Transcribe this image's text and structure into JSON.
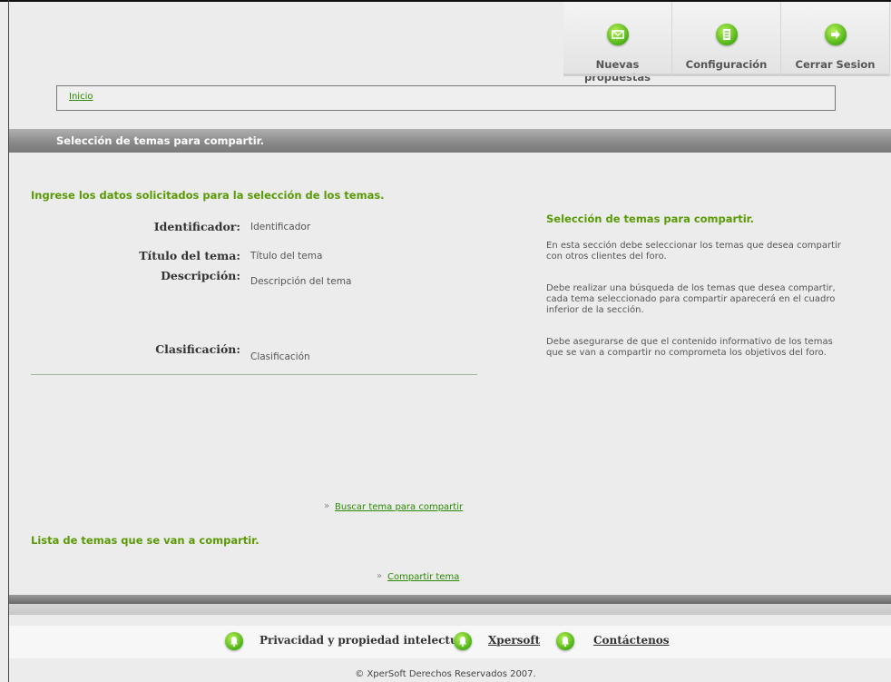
{
  "topnav": {
    "items": [
      {
        "label": "Nuevas propuestas",
        "icon": "envelope-icon"
      },
      {
        "label": "Configuración",
        "icon": "document-icon"
      },
      {
        "label": "Cerrar Sesion",
        "icon": "arrow-right-icon"
      }
    ]
  },
  "breadcrumb": {
    "home": "Inicio"
  },
  "section": {
    "title": "Selección de temas para compartir."
  },
  "form": {
    "instruction": "Ingrese los datos solicitados para la selección de los temas.",
    "fields": [
      {
        "label": "Identificador:",
        "value": "Identificador"
      },
      {
        "label": "Título del tema:",
        "value": "Título del tema"
      },
      {
        "label": "Descripción:",
        "value": "Descripción del tema"
      },
      {
        "label": "Clasificación:",
        "value": "Clasificación"
      }
    ],
    "search_link": "Buscar tema para compartir"
  },
  "help": {
    "title": "Selección de temas para compartir.",
    "paragraphs": [
      "En esta sección debe seleccionar los temas que desea compartir con otros clientes del foro.",
      "Debe realizar una búsqueda de los temas que desea compartir, cada tema seleccionado para compartir aparecerá en el cuadro inferior de la sección.",
      "Debe asegurarse de que el contenido informativo de los temas que se van a compartir no comprometa los objetivos del foro."
    ]
  },
  "list": {
    "title": "Lista de temas que se van a compartir.",
    "share_link": "Compartir tema"
  },
  "footer": {
    "links": [
      {
        "label": "Privacidad y propiedad intelectual"
      },
      {
        "label": "Xpersoft"
      },
      {
        "label": "Contáctenos"
      }
    ],
    "copyright": "© XperSoft Derechos Reservados 2007."
  },
  "colors": {
    "accent_green": "#5a9a06",
    "link_green": "#2a8a00",
    "bar_gray": "#888888"
  }
}
